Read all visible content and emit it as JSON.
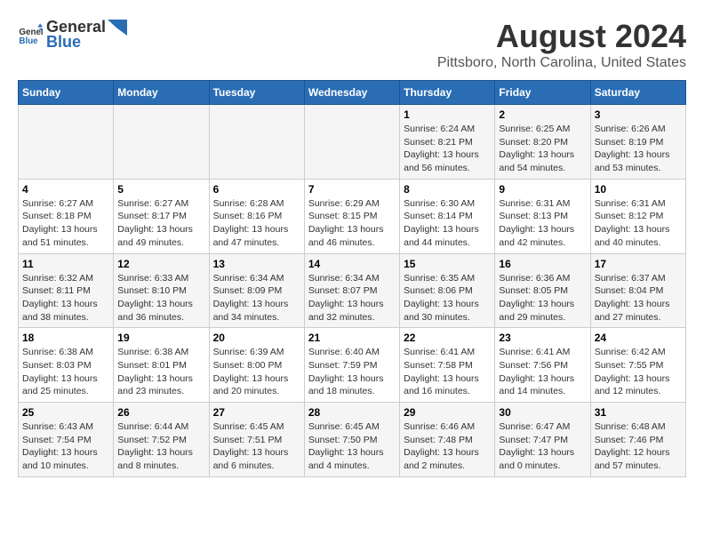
{
  "header": {
    "logo_general": "General",
    "logo_blue": "Blue",
    "title": "August 2024",
    "subtitle": "Pittsboro, North Carolina, United States"
  },
  "days_of_week": [
    "Sunday",
    "Monday",
    "Tuesday",
    "Wednesday",
    "Thursday",
    "Friday",
    "Saturday"
  ],
  "weeks": [
    [
      {
        "day": "",
        "sunrise": "",
        "sunset": "",
        "daylight": ""
      },
      {
        "day": "",
        "sunrise": "",
        "sunset": "",
        "daylight": ""
      },
      {
        "day": "",
        "sunrise": "",
        "sunset": "",
        "daylight": ""
      },
      {
        "day": "",
        "sunrise": "",
        "sunset": "",
        "daylight": ""
      },
      {
        "day": "1",
        "sunrise": "6:24 AM",
        "sunset": "8:21 PM",
        "daylight": "13 hours and 56 minutes."
      },
      {
        "day": "2",
        "sunrise": "6:25 AM",
        "sunset": "8:20 PM",
        "daylight": "13 hours and 54 minutes."
      },
      {
        "day": "3",
        "sunrise": "6:26 AM",
        "sunset": "8:19 PM",
        "daylight": "13 hours and 53 minutes."
      }
    ],
    [
      {
        "day": "4",
        "sunrise": "6:27 AM",
        "sunset": "8:18 PM",
        "daylight": "13 hours and 51 minutes."
      },
      {
        "day": "5",
        "sunrise": "6:27 AM",
        "sunset": "8:17 PM",
        "daylight": "13 hours and 49 minutes."
      },
      {
        "day": "6",
        "sunrise": "6:28 AM",
        "sunset": "8:16 PM",
        "daylight": "13 hours and 47 minutes."
      },
      {
        "day": "7",
        "sunrise": "6:29 AM",
        "sunset": "8:15 PM",
        "daylight": "13 hours and 46 minutes."
      },
      {
        "day": "8",
        "sunrise": "6:30 AM",
        "sunset": "8:14 PM",
        "daylight": "13 hours and 44 minutes."
      },
      {
        "day": "9",
        "sunrise": "6:31 AM",
        "sunset": "8:13 PM",
        "daylight": "13 hours and 42 minutes."
      },
      {
        "day": "10",
        "sunrise": "6:31 AM",
        "sunset": "8:12 PM",
        "daylight": "13 hours and 40 minutes."
      }
    ],
    [
      {
        "day": "11",
        "sunrise": "6:32 AM",
        "sunset": "8:11 PM",
        "daylight": "13 hours and 38 minutes."
      },
      {
        "day": "12",
        "sunrise": "6:33 AM",
        "sunset": "8:10 PM",
        "daylight": "13 hours and 36 minutes."
      },
      {
        "day": "13",
        "sunrise": "6:34 AM",
        "sunset": "8:09 PM",
        "daylight": "13 hours and 34 minutes."
      },
      {
        "day": "14",
        "sunrise": "6:34 AM",
        "sunset": "8:07 PM",
        "daylight": "13 hours and 32 minutes."
      },
      {
        "day": "15",
        "sunrise": "6:35 AM",
        "sunset": "8:06 PM",
        "daylight": "13 hours and 30 minutes."
      },
      {
        "day": "16",
        "sunrise": "6:36 AM",
        "sunset": "8:05 PM",
        "daylight": "13 hours and 29 minutes."
      },
      {
        "day": "17",
        "sunrise": "6:37 AM",
        "sunset": "8:04 PM",
        "daylight": "13 hours and 27 minutes."
      }
    ],
    [
      {
        "day": "18",
        "sunrise": "6:38 AM",
        "sunset": "8:03 PM",
        "daylight": "13 hours and 25 minutes."
      },
      {
        "day": "19",
        "sunrise": "6:38 AM",
        "sunset": "8:01 PM",
        "daylight": "13 hours and 23 minutes."
      },
      {
        "day": "20",
        "sunrise": "6:39 AM",
        "sunset": "8:00 PM",
        "daylight": "13 hours and 20 minutes."
      },
      {
        "day": "21",
        "sunrise": "6:40 AM",
        "sunset": "7:59 PM",
        "daylight": "13 hours and 18 minutes."
      },
      {
        "day": "22",
        "sunrise": "6:41 AM",
        "sunset": "7:58 PM",
        "daylight": "13 hours and 16 minutes."
      },
      {
        "day": "23",
        "sunrise": "6:41 AM",
        "sunset": "7:56 PM",
        "daylight": "13 hours and 14 minutes."
      },
      {
        "day": "24",
        "sunrise": "6:42 AM",
        "sunset": "7:55 PM",
        "daylight": "13 hours and 12 minutes."
      }
    ],
    [
      {
        "day": "25",
        "sunrise": "6:43 AM",
        "sunset": "7:54 PM",
        "daylight": "13 hours and 10 minutes."
      },
      {
        "day": "26",
        "sunrise": "6:44 AM",
        "sunset": "7:52 PM",
        "daylight": "13 hours and 8 minutes."
      },
      {
        "day": "27",
        "sunrise": "6:45 AM",
        "sunset": "7:51 PM",
        "daylight": "13 hours and 6 minutes."
      },
      {
        "day": "28",
        "sunrise": "6:45 AM",
        "sunset": "7:50 PM",
        "daylight": "13 hours and 4 minutes."
      },
      {
        "day": "29",
        "sunrise": "6:46 AM",
        "sunset": "7:48 PM",
        "daylight": "13 hours and 2 minutes."
      },
      {
        "day": "30",
        "sunrise": "6:47 AM",
        "sunset": "7:47 PM",
        "daylight": "13 hours and 0 minutes."
      },
      {
        "day": "31",
        "sunrise": "6:48 AM",
        "sunset": "7:46 PM",
        "daylight": "12 hours and 57 minutes."
      }
    ]
  ]
}
